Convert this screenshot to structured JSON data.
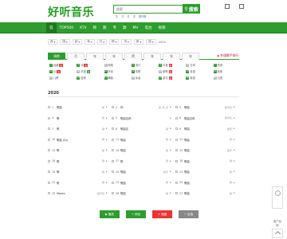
{
  "brand": {
    "logo": "好听音乐"
  },
  "search": {
    "placeholder": "搜索",
    "button": "搜索",
    "hot_words": [
      "热",
      "词",
      "热",
      "词",
      "排行榜"
    ]
  },
  "top_icons": [
    {
      "icon": "monitor-icon",
      "label": ""
    },
    {
      "icon": "phone-icon",
      "label": ""
    }
  ],
  "nav": {
    "items": [
      "首",
      "TOP500",
      "KTV",
      "榜",
      "歌",
      "专",
      "歌",
      "MV",
      "电台",
      "视频"
    ],
    "active": 0
  },
  "breadcrumb": {
    "items": [
      "首",
      "国",
      "欧",
      "粤",
      "日",
      "韩",
      "流",
      "新",
      "摇"
    ],
    "tail": "2024"
  },
  "tabs": {
    "items": [
      "周榜",
      "月",
      "年",
      "年",
      "榜",
      "年",
      "年",
      "年"
    ],
    "active": 0,
    "lang_link": "外国歌手排行"
  },
  "tags": [
    {
      "num": "1",
      "label": "经典",
      "badge": "热"
    },
    {
      "num": "2",
      "label": "流",
      "badge": "热"
    },
    {
      "num": "3",
      "label": "网络",
      "badge": ""
    },
    {
      "num": "4",
      "label": "流行",
      "badge": ""
    },
    {
      "num": "5",
      "label": "抖音",
      "badge": "热"
    },
    {
      "num": "6",
      "label": "古风",
      "badge": ""
    },
    {
      "num": "7",
      "label": "伤感",
      "badge": ""
    },
    {
      "num": "8",
      "label": "DJ",
      "badge": "热"
    },
    {
      "num": "9",
      "label": "华语",
      "badge": "新"
    },
    {
      "num": "10",
      "label": "怀旧",
      "badge": ""
    },
    {
      "num": "11",
      "label": "情歌",
      "badge": ""
    },
    {
      "num": "12",
      "label": "新歌",
      "badge": "热"
    },
    {
      "num": "13",
      "label": "粤语",
      "badge": ""
    },
    {
      "num": "14",
      "label": "纯音",
      "badge": ""
    },
    {
      "num": "15",
      "label": "儿歌",
      "badge": ""
    },
    {
      "num": "16",
      "label": "摇滚",
      "badge": ""
    },
    {
      "num": "17",
      "label": "舞曲",
      "badge": ""
    },
    {
      "num": "18",
      "label": "民谣",
      "badge": ""
    },
    {
      "num": "19",
      "label": "英文",
      "badge": "热"
    },
    {
      "num": "20",
      "label": "韩语",
      "badge": ""
    },
    {
      "num": "21",
      "label": "日语",
      "badge": ""
    }
  ],
  "section": {
    "title": "2020"
  },
  "songs": [
    {
      "idx": "1",
      "name": "歌曲",
      "singer": "歌"
    },
    {
      "idx": "2",
      "name": "你",
      "singer": "歌_手_名"
    },
    {
      "idx": "3",
      "name": "歌曲",
      "singer": "歌手名"
    },
    {
      "idx": "4",
      "name": "歌",
      "singer": "歌"
    },
    {
      "idx": "5",
      "name": "歌曲名称",
      "singer": ""
    },
    {
      "idx": "6",
      "name": "歌曲名称",
      "singer": "歌手名"
    },
    {
      "idx": "7",
      "name": "歌",
      "singer": "歌"
    },
    {
      "idx": "8",
      "name": "歌曲名",
      "singer": "歌"
    },
    {
      "idx": "9",
      "name": "歌曲",
      "singer": "歌手"
    },
    {
      "idx": "10",
      "name": "歌曲 (DJ)",
      "singer": "歌"
    },
    {
      "idx": "11",
      "name": "歌曲",
      "singer": "歌"
    },
    {
      "idx": "12",
      "name": "歌曲",
      "singer": "歌"
    },
    {
      "idx": "13",
      "name": "歌",
      "singer": "歌"
    },
    {
      "idx": "14",
      "name": "歌曲",
      "singer": "歌"
    },
    {
      "idx": "15",
      "name": "歌曲",
      "singer": "歌手"
    },
    {
      "idx": "16",
      "name": "歌",
      "singer": "歌"
    },
    {
      "idx": "17",
      "name": "歌",
      "singer": "歌"
    },
    {
      "idx": "18",
      "name": "歌曲",
      "singer": "歌"
    },
    {
      "idx": "19",
      "name": "歌",
      "singer": "歌"
    },
    {
      "idx": "20",
      "name": "歌曲",
      "singer": "歌手"
    },
    {
      "idx": "21",
      "name": "歌曲",
      "singer": "歌"
    },
    {
      "idx": "22",
      "name": "歌",
      "singer": "歌"
    },
    {
      "idx": "23",
      "name": "歌曲",
      "singer": "歌"
    },
    {
      "idx": "24",
      "name": "歌曲",
      "singer": "歌"
    },
    {
      "idx": "25",
      "name": "Manta",
      "singer": "歌手名"
    },
    {
      "idx": "26",
      "name": "歌曲",
      "singer": "歌"
    },
    {
      "idx": "27",
      "name": "歌曲",
      "singer": "歌"
    }
  ],
  "actions": {
    "play": "播放",
    "add": "添加",
    "collect": "收藏",
    "select": "全选"
  },
  "side": {
    "label": "用户反馈"
  },
  "colors": {
    "brand": "#2d9d2d",
    "hot": "#e33"
  }
}
